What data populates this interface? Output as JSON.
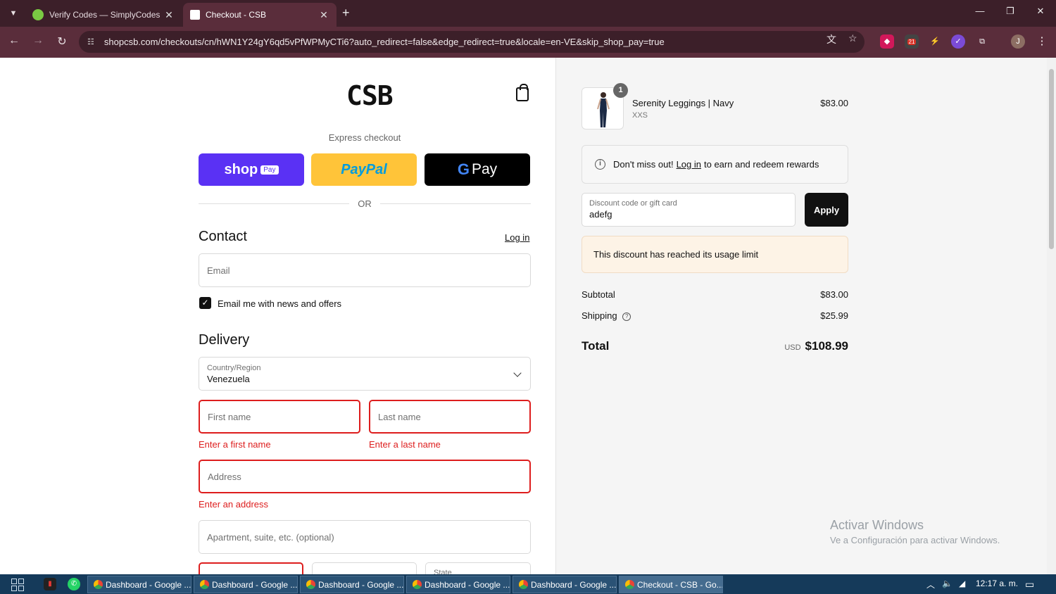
{
  "browser": {
    "tabs": [
      {
        "title": "Verify Codes — SimplyCodes",
        "active": false,
        "favicon": "simplycodes-icon"
      },
      {
        "title": "Checkout - CSB",
        "active": true,
        "favicon": "csb-icon"
      }
    ],
    "url": "shopcsb.com/checkouts/cn/hWN1Y24gY6qd5vPfWPMyCTi6?auto_redirect=false&edge_redirect=true&locale=en-VE&skip_shop_pay=true",
    "extension_badge": "21",
    "profile_initial": "J"
  },
  "checkout": {
    "logo": "CSB",
    "express_label": "Express checkout",
    "shop_pay": {
      "word": "shop",
      "pill": "Pay"
    },
    "paypal": {
      "part1": "Pay",
      "part2": "Pal"
    },
    "gpay": {
      "g": "G",
      "word": "Pay"
    },
    "or": "OR",
    "contact": {
      "heading": "Contact",
      "login": "Log in",
      "email_placeholder": "Email",
      "news_label": "Email me with news and offers",
      "news_checked": true
    },
    "delivery": {
      "heading": "Delivery",
      "country_label": "Country/Region",
      "country_value": "Venezuela",
      "first_name": "First name",
      "first_name_error": "Enter a first name",
      "last_name": "Last name",
      "last_name_error": "Enter a last name",
      "address": "Address",
      "address_error": "Enter an address",
      "apartment": "Apartment, suite, etc. (optional)",
      "state_label": "State"
    }
  },
  "summary": {
    "item": {
      "qty": "1",
      "name": "Serenity Leggings | Navy",
      "variant": "XXS",
      "price": "$83.00"
    },
    "rewards": {
      "before": "Don't miss out!",
      "link": "Log in",
      "after": "to earn and redeem rewards"
    },
    "discount": {
      "label": "Discount code or gift card",
      "value": "adefg",
      "apply": "Apply"
    },
    "warning": "This discount has reached its usage limit",
    "subtotal_label": "Subtotal",
    "subtotal": "$83.00",
    "shipping_label": "Shipping",
    "shipping": "$25.99",
    "total_label": "Total",
    "currency": "USD",
    "total": "$108.99"
  },
  "watermark": {
    "line1": "Activar Windows",
    "line2": "Ve a Configuración para activar Windows."
  },
  "taskbar": {
    "apps": [
      {
        "label": "Dashboard - Google ...",
        "active": false
      },
      {
        "label": "Dashboard - Google ...",
        "active": false
      },
      {
        "label": "Dashboard - Google ...",
        "active": false
      },
      {
        "label": "Dashboard - Google ...",
        "active": false
      },
      {
        "label": "Dashboard - Google ...",
        "active": false
      },
      {
        "label": "Checkout - CSB - Go...",
        "active": true
      }
    ],
    "clock": "12:17 a. m."
  }
}
